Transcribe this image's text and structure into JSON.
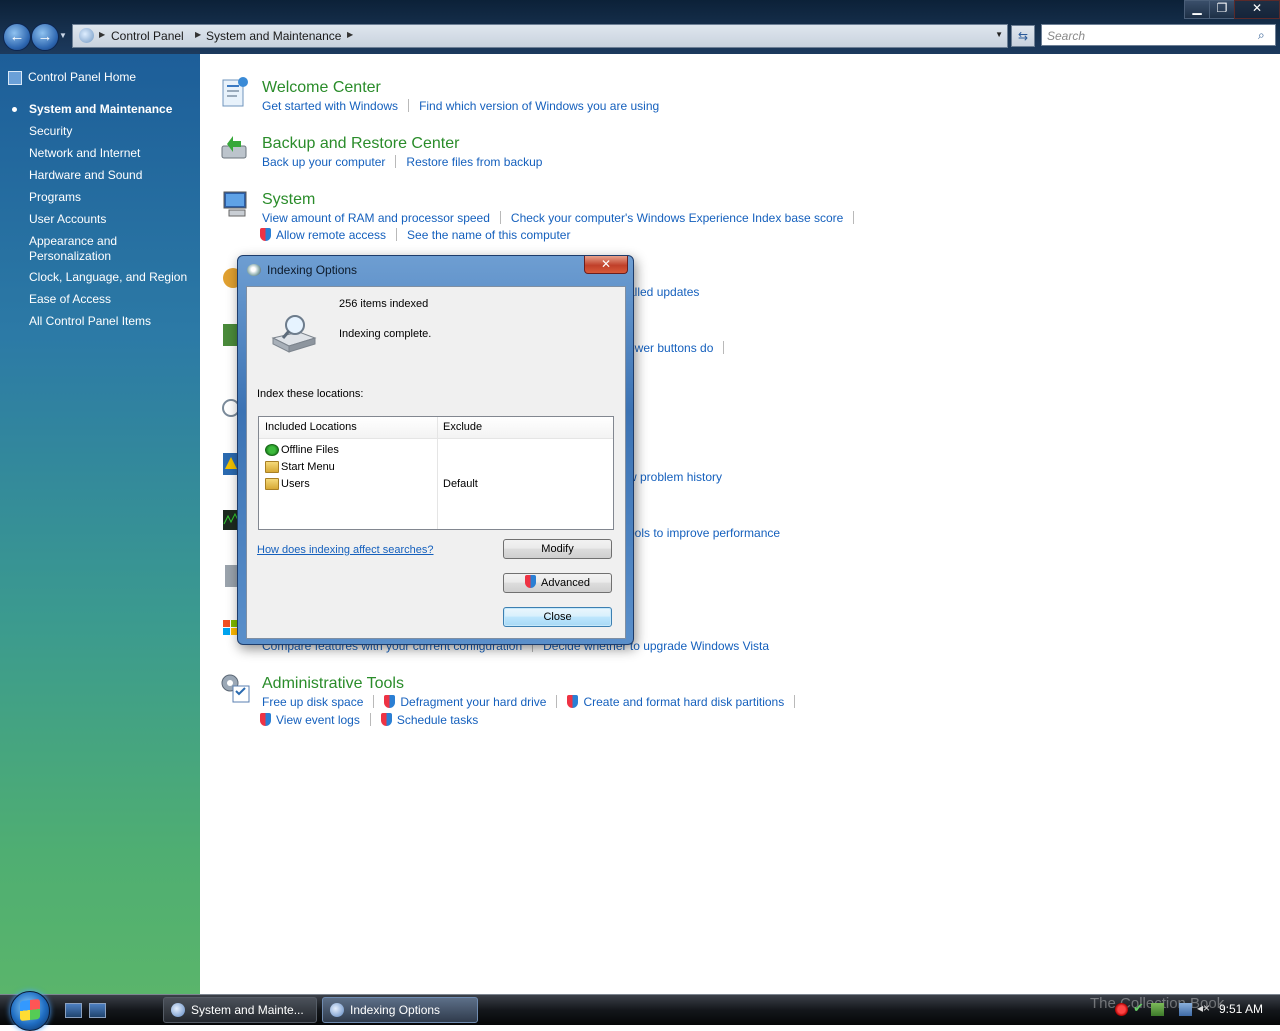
{
  "window": {
    "controls": {
      "minimize": "▁",
      "maximize": "❐",
      "close": "✕"
    }
  },
  "nav": {
    "back": "←",
    "forward": "→",
    "dropdown": "▼"
  },
  "address": {
    "crumbs": [
      "Control Panel",
      "System and Maintenance"
    ],
    "separator": "▶",
    "dropdown": "▼",
    "refresh": "⇆"
  },
  "search": {
    "placeholder": "Search",
    "icon": "⌕"
  },
  "sidebar": {
    "home": "Control Panel Home",
    "items": [
      {
        "label": "System and Maintenance",
        "current": true
      },
      {
        "label": "Security"
      },
      {
        "label": "Network and Internet"
      },
      {
        "label": "Hardware and Sound"
      },
      {
        "label": "Programs"
      },
      {
        "label": "User Accounts"
      },
      {
        "label": "Appearance and Personalization"
      },
      {
        "label": "Clock, Language, and Region"
      },
      {
        "label": "Ease of Access"
      },
      {
        "label": "All Control Panel Items"
      }
    ]
  },
  "categories": {
    "welcome": {
      "title": "Welcome Center",
      "links": [
        "Get started with Windows",
        "Find which version of Windows you are using"
      ]
    },
    "backup": {
      "title": "Backup and Restore Center",
      "links": [
        "Back up your computer",
        "Restore files from backup"
      ]
    },
    "system": {
      "title": "System",
      "links": [
        "View amount of RAM and processor speed",
        "Check your computer's Windows Experience Index base score",
        "Allow remote access",
        "See the name of this computer"
      ]
    },
    "partial": {
      "update_tail": "alled updates",
      "power_tail": "ower buttons do",
      "problem_tail": "w problem history",
      "perf_tail": "ools to improve performance",
      "upgrade_links": [
        "Compare features with your current configuration",
        "Decide whether to upgrade Windows Vista"
      ]
    },
    "admin": {
      "title": "Administrative Tools",
      "links": [
        "Free up disk space",
        "Defragment your hard drive",
        "Create and format hard disk partitions",
        "View event logs",
        "Schedule tasks"
      ]
    }
  },
  "dialog": {
    "title": "Indexing Options",
    "close": "✕",
    "items_indexed": "256 items indexed",
    "status": "Indexing complete.",
    "index_label": "Index these locations:",
    "columns": [
      "Included Locations",
      "Exclude"
    ],
    "locations": [
      {
        "name": "Offline Files",
        "exclude": ""
      },
      {
        "name": "Start Menu",
        "exclude": ""
      },
      {
        "name": "Users",
        "exclude": "Default"
      }
    ],
    "help_link": "How does indexing affect searches?",
    "buttons": {
      "modify": "Modify",
      "advanced": "Advanced",
      "close": "Close"
    }
  },
  "taskbar": {
    "tasks": [
      "System and Mainte...",
      "Indexing Options"
    ],
    "clock": "9:51 AM",
    "tray_check": "✔",
    "tray_speaker": "◂×",
    "watermark": "The Collection Book"
  },
  "colors": {
    "accent": "#1560bd",
    "category_title": "#2a8c2a",
    "sidebar_top": "#1d5e99",
    "sidebar_bottom": "#5ab56b"
  }
}
